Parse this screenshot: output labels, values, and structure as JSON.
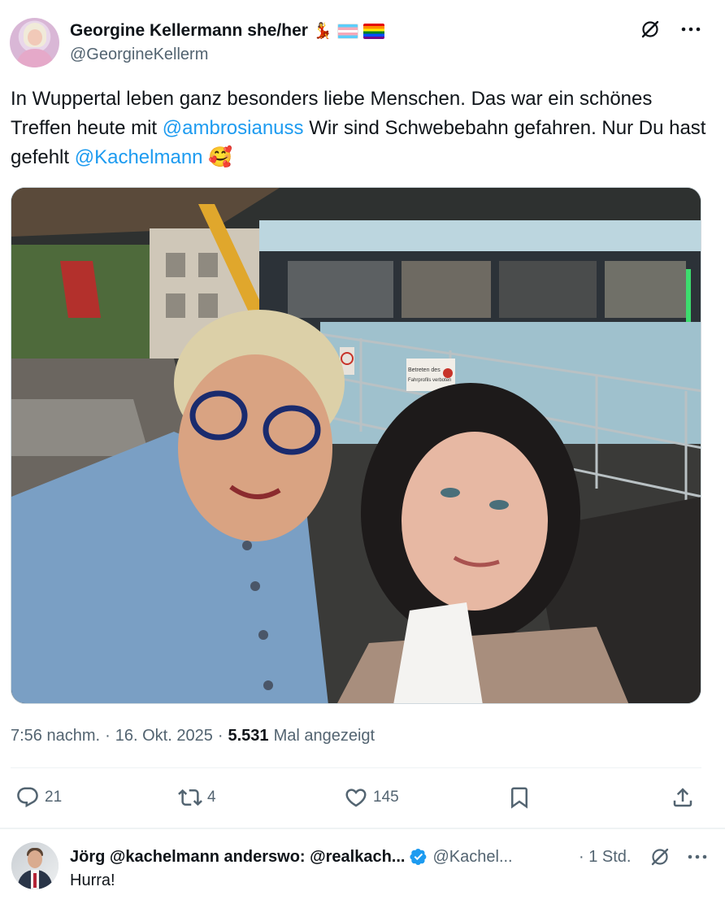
{
  "post": {
    "author_name": "Georgine Kellermann she/her",
    "author_emoji": "💃",
    "author_handle": "@GeorgineKellerm",
    "text_part1": "In Wuppertal leben ganz besonders liebe Menschen. Das war ein schönes Treffen heute mit ",
    "mention1": "@ambrosianuss",
    "text_part2": " Wir sind Schwebebahn gefahren. Nur Du hast gefehlt ",
    "mention2": "@Kachelmann",
    "text_emoji": "🥰",
    "time": "7:56 nachm.",
    "date": "16. Okt. 2025",
    "views": "5.531",
    "views_label": "Mal angezeigt",
    "dot": "·",
    "replies": "21",
    "reposts": "4",
    "likes": "145"
  },
  "photo": {
    "sign_line1": "Betreten des",
    "sign_line2": "Fahrprofils verboten"
  },
  "reply": {
    "author_name": "Jörg @kachelmann anderswo: @realkach...",
    "author_handle": "@Kachel...",
    "time": "· 1 Std.",
    "text": "Hurra!"
  },
  "colors": {
    "link": "#1d9bf0",
    "secondary_text": "#536471",
    "verified": "#1d9bf0"
  }
}
